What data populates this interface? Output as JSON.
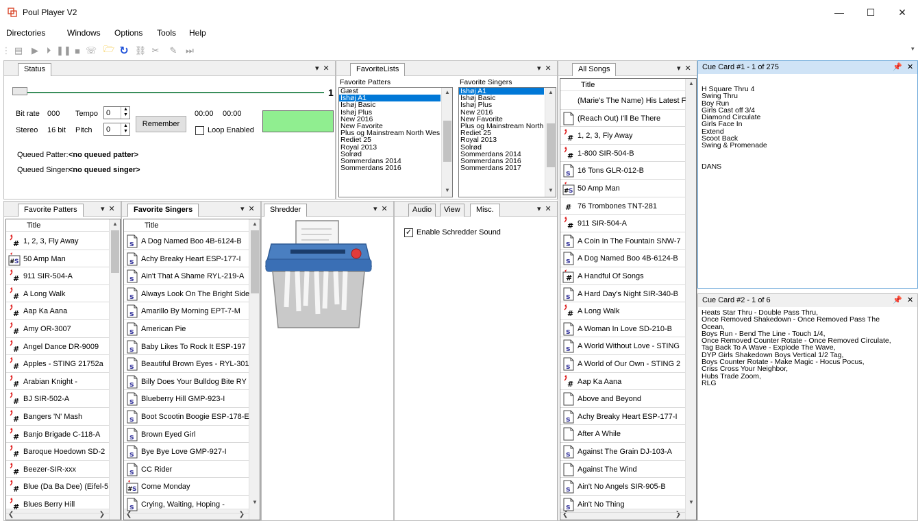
{
  "app": {
    "title": "Poul Player V2",
    "accent": "#0078d7"
  },
  "window_controls": {
    "minimize": "—",
    "maximize": "☐",
    "close": "✕"
  },
  "menu": [
    "Directories",
    "Windows",
    "Options",
    "Tools",
    "Help"
  ],
  "status": {
    "tab": "Status",
    "seek_value_partial": "1",
    "bitrate_label": "Bit rate",
    "bitrate_value": "000",
    "tempo_label": "Tempo",
    "tempo_value": "0",
    "stereo_label": "Stereo",
    "bits_label": "16 bit",
    "pitch_label": "Pitch",
    "pitch_value": "0",
    "time_elapsed": "00:00",
    "time_total": "00:00",
    "remember_label": "Remember",
    "loop_label": "Loop Enabled",
    "queued_patter_label": "Queued Patter:",
    "queued_patter_value": "<no queued patter>",
    "queued_singer_label": "Queued Singer:",
    "queued_singer_value": "<no queued singer>",
    "indicator_color": "#90ee90"
  },
  "favoritelists": {
    "tab": "FavoriteLists",
    "patters_header": "Favorite Patters",
    "singers_header": "Favorite Singers",
    "patters": [
      "Gæst",
      "Ishøj A1",
      "Ishøj Basic",
      "Ishøj Plus",
      "New 2016",
      "New Favorite",
      "Plus og Mainstream North Wes",
      "Rediet 25",
      "Royal 2013",
      "Solrød",
      "Sommerdans 2014",
      "Sommerdans 2016"
    ],
    "patters_selected": 1,
    "singers": [
      "Ishøj A1",
      "Ishøj Basic",
      "Ishøj Plus",
      "New 2016",
      "New Favorite",
      "Plus og Mainstream North",
      "Rediet 25",
      "Royal 2013",
      "Solrød",
      "Sommerdans 2014",
      "Sommerdans 2016",
      "Sommerdans 2017"
    ],
    "singers_selected": 0
  },
  "allsongs": {
    "tab": "All Songs",
    "column": "Title",
    "rows": [
      {
        "t": "(Marie's The Name) His Latest F",
        "i": "none"
      },
      {
        "t": "(Reach Out) I'll Be There",
        "i": "blank"
      },
      {
        "t": "1, 2, 3, Fly Away",
        "i": "patter"
      },
      {
        "t": "1-800 SIR-504-B",
        "i": "patter"
      },
      {
        "t": "16 Tons GLR-012-B",
        "i": "singer"
      },
      {
        "t": "50 Amp Man",
        "i": "hs"
      },
      {
        "t": "76 Trombones TNT-281",
        "i": "hash"
      },
      {
        "t": "911 SIR-504-A",
        "i": "patter"
      },
      {
        "t": "A Coin In The Fountain SNW-7",
        "i": "singer"
      },
      {
        "t": "A Dog Named Boo 4B-6124-B",
        "i": "singer"
      },
      {
        "t": "A Handful Of Songs",
        "i": "hbox"
      },
      {
        "t": "A Hard Day's Night SIR-340-B",
        "i": "singer"
      },
      {
        "t": "A Long Walk",
        "i": "patter"
      },
      {
        "t": "A Woman In Love SD-210-B",
        "i": "singer"
      },
      {
        "t": "A World Without Love - STING",
        "i": "singer"
      },
      {
        "t": "A World of Our Own - STING 2",
        "i": "singer"
      },
      {
        "t": "Aap Ka Aana",
        "i": "patter"
      },
      {
        "t": "Above and Beyond",
        "i": "blank"
      },
      {
        "t": "Achy Breaky Heart ESP-177-I",
        "i": "singer"
      },
      {
        "t": "After A While",
        "i": "blank"
      },
      {
        "t": "Against The Grain DJ-103-A",
        "i": "singer"
      },
      {
        "t": "Against The Wind",
        "i": "blank"
      },
      {
        "t": "Ain't No Angels SIR-905-B",
        "i": "singer"
      },
      {
        "t": "Ain't No Thing",
        "i": "singer"
      }
    ]
  },
  "cuecard1": {
    "title": "Cue Card #1 - 1 of 275",
    "text": "H Square Thru 4\nSwing Thru\nBoy Run\nGirls Cast off 3/4\nDiamond Circulate\nGirls Face In\nExtend\nScoot Back\nSwing & Promenade\n\n\nDANS"
  },
  "cuecard2": {
    "title": "Cue Card #2 - 1 of 6",
    "text": "Heats Star Thru - Double Pass Thru,\nOnce Removed Shakedown - Once Removed Pass The\nOcean,\nBoys Run - Bend The Line - Touch 1/4,\nOnce Removed Counter Rotate - Once Removed Circulate,\nTag Back To A Wave - Explode The Wave,\nDYP Girls Shakedown Boys Vertical 1/2 Tag,\nBoys Counter Rotate - Make Magic - Hocus Pocus,\nCriss Cross Your Neighbor,\nHubs Trade Zoom,\nRLG"
  },
  "favpatters": {
    "tab": "Favorite Patters",
    "column": "Title",
    "rows": [
      {
        "t": "1, 2, 3, Fly Away",
        "i": "patter"
      },
      {
        "t": "50 Amp Man",
        "i": "hs"
      },
      {
        "t": "911 SIR-504-A",
        "i": "patter"
      },
      {
        "t": "A Long Walk",
        "i": "patter"
      },
      {
        "t": "Aap Ka Aana",
        "i": "patter"
      },
      {
        "t": "Amy OR-3007",
        "i": "patter"
      },
      {
        "t": "Angel Dance DR-9009",
        "i": "patter"
      },
      {
        "t": "Apples - STING 21752a",
        "i": "patter"
      },
      {
        "t": "Arabian Knight -",
        "i": "patter"
      },
      {
        "t": "BJ SIR-502-A",
        "i": "patter"
      },
      {
        "t": "Bangers 'N' Mash",
        "i": "patter"
      },
      {
        "t": "Banjo Brigade C-118-A",
        "i": "patter"
      },
      {
        "t": "Baroque Hoedown SD-2",
        "i": "patter"
      },
      {
        "t": "Beezer-SIR-xxx",
        "i": "patter"
      },
      {
        "t": "Blue (Da Ba Dee) (Eifel-5",
        "i": "patter"
      },
      {
        "t": "Blues Berry Hill",
        "i": "patter"
      }
    ]
  },
  "favsingers": {
    "tab": "Favorite Singers",
    "column": "Title",
    "rows": [
      {
        "t": "A Dog Named Boo 4B-6124-B",
        "i": "singer"
      },
      {
        "t": "Achy Breaky Heart ESP-177-I",
        "i": "singer"
      },
      {
        "t": "Ain't That A Shame RYL-219-A",
        "i": "singer"
      },
      {
        "t": "Always Look On The Bright Side",
        "i": "singer"
      },
      {
        "t": "Amarillo By Morning EPT-7-M",
        "i": "singer"
      },
      {
        "t": "American Pie",
        "i": "singer"
      },
      {
        "t": "Baby Likes To Rock It ESP-197",
        "i": "singer"
      },
      {
        "t": "Beautiful Brown Eyes - RYL-301",
        "i": "singer"
      },
      {
        "t": "Billy Does Your Bulldog Bite RY",
        "i": "singer"
      },
      {
        "t": "Blueberry Hill GMP-923-I",
        "i": "singer"
      },
      {
        "t": "Boot Scootin Boogie ESP-178-E",
        "i": "singer"
      },
      {
        "t": "Brown Eyed Girl",
        "i": "singer"
      },
      {
        "t": "Bye Bye Love GMP-927-I",
        "i": "singer"
      },
      {
        "t": "CC Rider",
        "i": "singer"
      },
      {
        "t": "Come Monday",
        "i": "hs"
      },
      {
        "t": "Crying, Waiting, Hoping -",
        "i": "singer"
      }
    ]
  },
  "shredder": {
    "tab": "Shredder"
  },
  "misc": {
    "tabs": [
      "Audio",
      "View",
      "Misc."
    ],
    "active_tab": "Misc.",
    "enable_sound_label": "Enable Schredder Sound",
    "enable_sound_checked": true
  }
}
